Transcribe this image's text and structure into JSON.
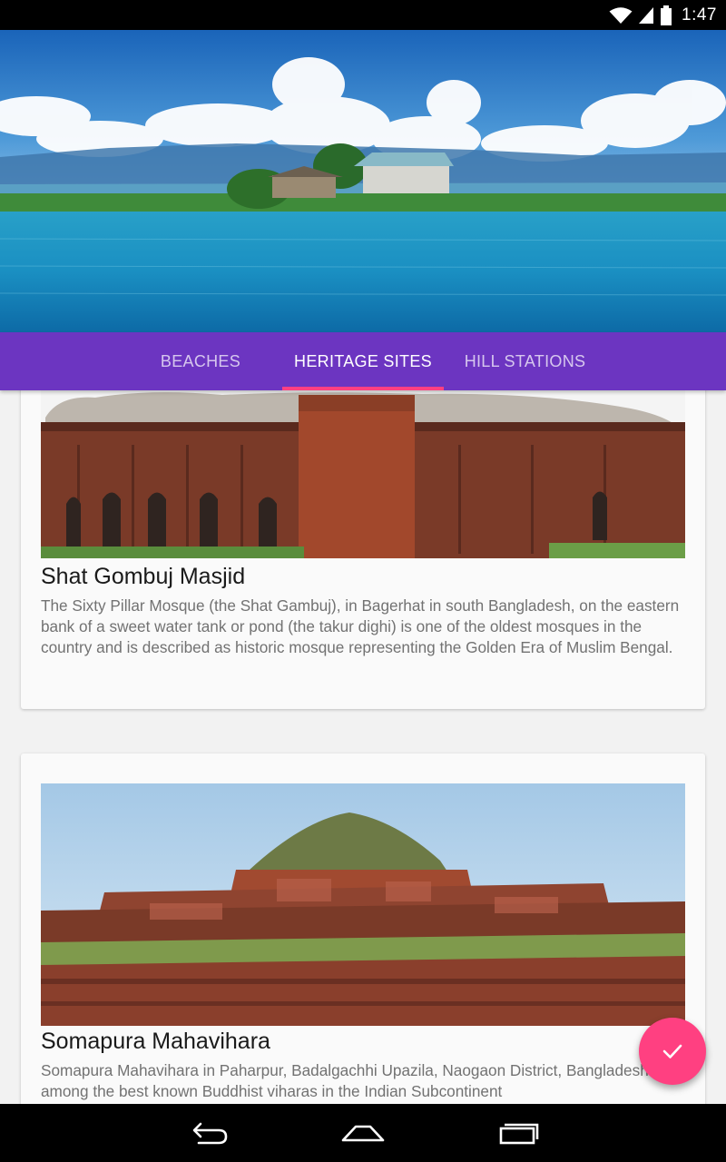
{
  "status_bar": {
    "time": "1:47",
    "icons": [
      "wifi-icon",
      "signal-icon",
      "battery-icon"
    ]
  },
  "header": {
    "image": "lake-house-landscape"
  },
  "tabs": [
    {
      "label": "BEACHES",
      "active": false
    },
    {
      "label": "HERITAGE SITES",
      "active": true
    },
    {
      "label": "HILL STATIONS",
      "active": false
    }
  ],
  "cards": [
    {
      "image": "shat-gombuj-mosque-photo",
      "title": "Shat Gombuj Masjid",
      "description": "The Sixty Pillar Mosque (the Shat Gambuj), in Bagerhat in south Bangladesh, on the eastern bank of a sweet water tank or pond (the takur dighi) is one of the oldest mosques in the country and is described as historic mosque representing the Golden Era of Muslim Bengal."
    },
    {
      "image": "somapura-mahavihara-photo",
      "title": "Somapura Mahavihara",
      "description": "Somapura Mahavihara in Paharpur, Badalgachhi Upazila, Naogaon District, Bangladesh is among the best known Buddhist viharas in the Indian Subcontinent"
    }
  ],
  "fab": {
    "icon": "check-icon"
  },
  "nav_bar": {
    "icons": [
      "back-icon",
      "home-icon",
      "recents-icon"
    ]
  },
  "colors": {
    "primary": "#6c35c1",
    "accent": "#ff4081",
    "status_bar": "#000000"
  }
}
